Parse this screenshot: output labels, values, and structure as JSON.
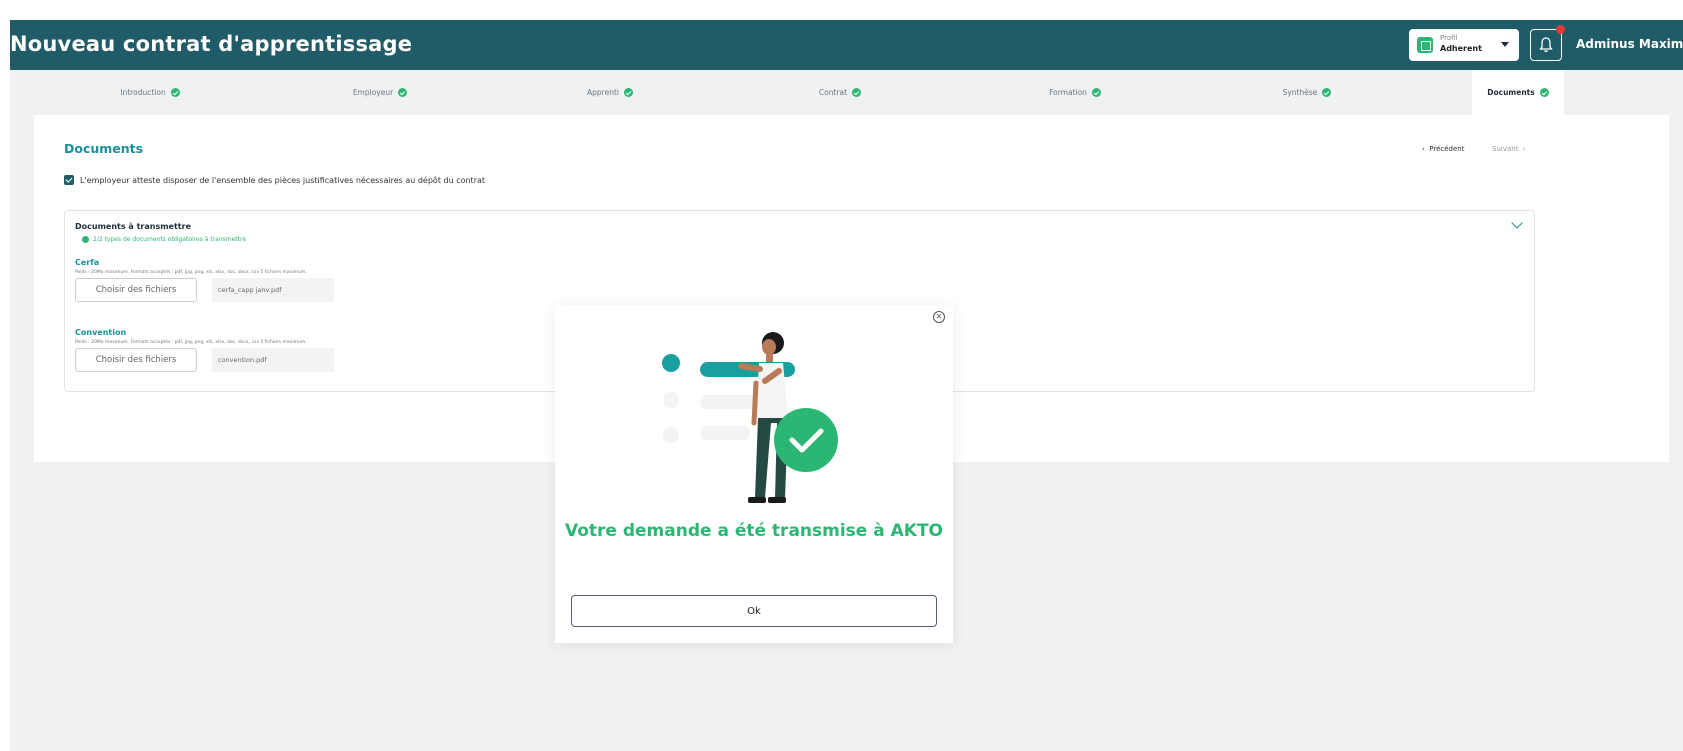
{
  "header": {
    "title": "Nouveau contrat d'apprentissage",
    "profile": {
      "caption": "Profil",
      "value": "Adherent"
    },
    "user_name": "Adminus Maximus"
  },
  "tabs": [
    {
      "label": "Introduction",
      "done": true
    },
    {
      "label": "Employeur",
      "done": true
    },
    {
      "label": "Apprenti",
      "done": true
    },
    {
      "label": "Contrat",
      "done": true
    },
    {
      "label": "Formation",
      "done": true
    },
    {
      "label": "Synthèse",
      "done": true
    },
    {
      "label": "Documents",
      "done": true,
      "active": true
    }
  ],
  "main": {
    "title": "Documents",
    "nav": {
      "prev": "Précédent",
      "next": "Suivant"
    },
    "attest_label": "L'employeur atteste disposer de l'ensemble des pièces justificatives nécessaires au dépôt du contrat",
    "card": {
      "title": "Documents à transmettre",
      "status": "2/2 types de documents obligatoires à transmettre",
      "sections": [
        {
          "title": "Cerfa",
          "hint": "Poids : 20Mo maximum. Formats acceptés : pdf, jpg, png, xls, xlsx, doc, docx, csv 5 fichiers maximum.",
          "button": "Choisir des fichiers",
          "file": "cerfa_capp janv.pdf"
        },
        {
          "title": "Convention",
          "hint": "Poids : 20Mo maximum. Formats acceptés : pdf, jpg, png, xls, xlsx, doc, docx, csv 5 fichiers maximum.",
          "button": "Choisir des fichiers",
          "file": "convention.pdf"
        }
      ]
    }
  },
  "modal": {
    "message": "Votre demande a été transmise à AKTO",
    "ok_label": "Ok"
  },
  "colors": {
    "header": "#1f5c67",
    "accent_teal": "#1a8f9d",
    "success_green": "#2bb673",
    "notification_red": "#e53935"
  },
  "icons": {
    "profile": "building-icon",
    "notifications": "bell-icon",
    "tab_status": "check-circle-icon",
    "modal_close": "close-icon",
    "card_toggle": "chevron-down-icon"
  }
}
